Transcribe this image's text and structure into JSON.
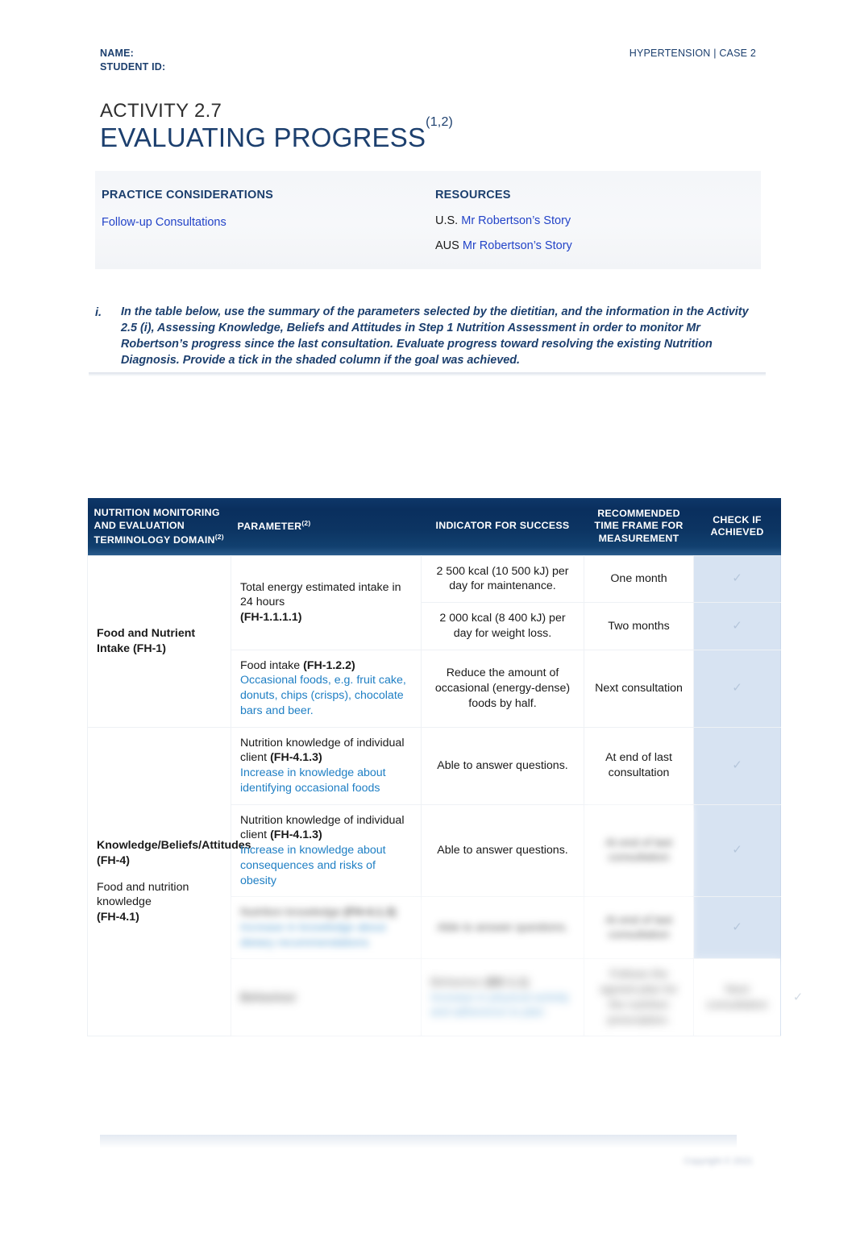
{
  "header": {
    "name_label": "NAME:",
    "student_id_label": "STUDENT ID:",
    "case_label": "HYPERTENSION | CASE 2"
  },
  "title": {
    "activity_number": "ACTIVITY 2.7",
    "activity_name": "EVALUATING PROGRESS",
    "superscript": "(1,2)"
  },
  "info_band": {
    "practice_heading": "PRACTICE CONSIDERATIONS",
    "practice_link": "Follow-up Consultations",
    "resources_heading": "RESOURCES",
    "resources": [
      {
        "region": "U.S.",
        "link": "Mr Robertson’s Story"
      },
      {
        "region": "AUS",
        "link": "Mr Robertson’s Story"
      }
    ]
  },
  "instruction": {
    "marker": "i.",
    "text": "In the table below, use the summary of the parameters selected by the dietitian, and the information in the Activity 2.5 (i), Assessing Knowledge, Beliefs and Attitudes in Step 1 Nutrition Assessment in order to monitor Mr Robertson’s progress since the last consultation. Evaluate progress toward resolving the existing Nutrition Diagnosis. Provide a tick in the shaded column if the goal was achieved."
  },
  "table": {
    "headers": {
      "domain": "NUTRITION MONITORING AND EVALUATION TERMINOLOGY DOMAIN",
      "domain_sup": "(2)",
      "parameter": "PARAMETER",
      "parameter_sup": "(2)",
      "indicator": "INDICATOR FOR SUCCESS",
      "timeframe": "RECOMMENDED TIME FRAME FOR MEASUREMENT",
      "check": "CHECK IF ACHIEVED"
    },
    "domains": [
      {
        "main": "Food and Nutrient Intake (FH-1)",
        "sub": "",
        "sub_code": ""
      },
      {
        "main": "Knowledge/Beliefs/Attitudes (FH-4)",
        "sub": "Food and nutrition knowledge",
        "sub_code": "(FH-4.1)"
      }
    ],
    "rows": [
      {
        "parameter_text": "Total energy estimated intake in 24 hours",
        "parameter_code": "(FH-1.1.1.1)",
        "parameter_note": "",
        "indicator": "2 500 kcal (10 500 kJ) per day for maintenance.",
        "timeframe": "One month",
        "check": "",
        "blurred": false
      },
      {
        "parameter_text": "",
        "parameter_code": "",
        "parameter_note": "",
        "indicator": "2 000 kcal (8 400 kJ) per day for weight loss.",
        "timeframe": "Two months",
        "check": "",
        "blurred": false
      },
      {
        "parameter_text": "Food intake ",
        "parameter_code": "(FH-1.2.2)",
        "parameter_note": "Occasional foods, e.g. fruit cake, donuts, chips (crisps), chocolate bars and beer.",
        "indicator": "Reduce the amount of occasional (energy-dense) foods by half.",
        "timeframe": "Next consultation",
        "check": "",
        "blurred": false
      },
      {
        "parameter_text": "Nutrition knowledge of individual client ",
        "parameter_code": "(FH-4.1.3)",
        "parameter_note": "Increase in knowledge about identifying occasional foods",
        "indicator": "Able to answer questions.",
        "timeframe": "At end of last consultation",
        "check": "",
        "blurred": false
      },
      {
        "parameter_text": "Nutrition knowledge of individual client ",
        "parameter_code": "(FH-4.1.3)",
        "parameter_note": "Increase in knowledge about consequences and risks of obesity",
        "indicator": "Able to answer questions.",
        "timeframe": "At end of last consultation",
        "check": "",
        "blurred": false,
        "timeframe_blurred": true
      },
      {
        "parameter_text": "Nutrition knowledge ",
        "parameter_code": "(FH-4.1.3)",
        "parameter_note": "Increase in knowledge about dietary recommendations",
        "indicator": "Able to answer questions.",
        "timeframe": "At end of last consultation",
        "check": "",
        "blurred": true
      },
      {
        "parameter_text": "Behaviour ",
        "parameter_code": "(BE-1.1)",
        "parameter_note": "Increase in physical activity and adherence to plan",
        "indicator": "Follows the agreed plan for the nutrition prescription.",
        "timeframe": "Next consultation",
        "check": "",
        "blurred": true
      }
    ],
    "check_glyph": "✓"
  },
  "footer": {
    "note": "Copyright © 2021"
  },
  "colors": {
    "brand_navy": "#1c3f6e",
    "header_dark": "#0c3462",
    "link_blue": "#2344c8",
    "note_blue": "#1f7fc4",
    "check_col_bg": "#d7e3f2"
  }
}
